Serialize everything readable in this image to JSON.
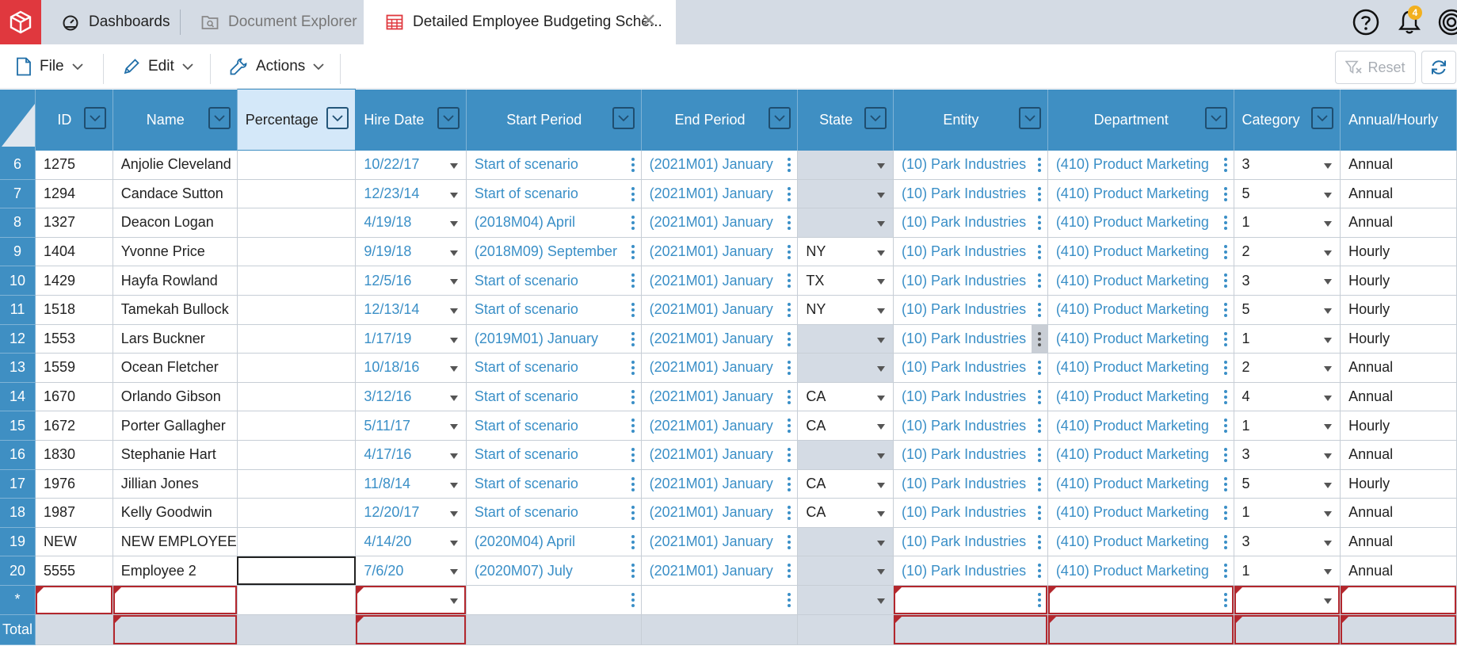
{
  "tabs": {
    "dashboards": "Dashboards",
    "document_explorer": "Document Explorer",
    "active": "Detailed Employee Budgeting Sche..."
  },
  "topbar": {
    "notification_count": "4",
    "close_glyph": "✕"
  },
  "toolbar": {
    "file": "File",
    "edit": "Edit",
    "actions": "Actions",
    "reset": "Reset"
  },
  "columns": {
    "id": "ID",
    "name": "Name",
    "percentage": "Percentage",
    "hire_date": "Hire Date",
    "start_period": "Start Period",
    "end_period": "End Period",
    "state": "State",
    "entity": "Entity",
    "department": "Department",
    "category": "Category",
    "annual_hourly": "Annual/Hourly"
  },
  "rows": [
    {
      "rn": "6",
      "id": "1275",
      "name": "Anjolie Cleveland",
      "pct": "",
      "hire": "10/22/17",
      "start": "Start of scenario",
      "end": "(2021M01) January",
      "state": "",
      "entity": "(10) Park Industries",
      "dept": "(410) Product Marketing",
      "cat": "3",
      "ah": "Annual"
    },
    {
      "rn": "7",
      "id": "1294",
      "name": "Candace Sutton",
      "pct": "",
      "hire": "12/23/14",
      "start": "Start of scenario",
      "end": "(2021M01) January",
      "state": "",
      "entity": "(10) Park Industries",
      "dept": "(410) Product Marketing",
      "cat": "5",
      "ah": "Annual"
    },
    {
      "rn": "8",
      "id": "1327",
      "name": "Deacon Logan",
      "pct": "",
      "hire": "4/19/18",
      "start": "(2018M04) April",
      "end": "(2021M01) January",
      "state": "",
      "entity": "(10) Park Industries",
      "dept": "(410) Product Marketing",
      "cat": "1",
      "ah": "Annual"
    },
    {
      "rn": "9",
      "id": "1404",
      "name": "Yvonne Price",
      "pct": "",
      "hire": "9/19/18",
      "start": "(2018M09) September",
      "end": "(2021M01) January",
      "state": "NY",
      "entity": "(10) Park Industries",
      "dept": "(410) Product Marketing",
      "cat": "2",
      "ah": "Hourly"
    },
    {
      "rn": "10",
      "id": "1429",
      "name": "Hayfa Rowland",
      "pct": "",
      "hire": "12/5/16",
      "start": "Start of scenario",
      "end": "(2021M01) January",
      "state": "TX",
      "entity": "(10) Park Industries",
      "dept": "(410) Product Marketing",
      "cat": "3",
      "ah": "Hourly"
    },
    {
      "rn": "11",
      "id": "1518",
      "name": "Tamekah Bullock",
      "pct": "",
      "hire": "12/13/14",
      "start": "Start of scenario",
      "end": "(2021M01) January",
      "state": "NY",
      "entity": "(10) Park Industries",
      "dept": "(410) Product Marketing",
      "cat": "5",
      "ah": "Hourly"
    },
    {
      "rn": "12",
      "id": "1553",
      "name": "Lars Buckner",
      "pct": "",
      "hire": "1/17/19",
      "start": "(2019M01) January",
      "end": "(2021M01) January",
      "state": "",
      "entity": "(10) Park Industries",
      "dept": "(410) Product Marketing",
      "cat": "1",
      "ah": "Hourly"
    },
    {
      "rn": "13",
      "id": "1559",
      "name": "Ocean Fletcher",
      "pct": "",
      "hire": "10/18/16",
      "start": "Start of scenario",
      "end": "(2021M01) January",
      "state": "",
      "entity": "(10) Park Industries",
      "dept": "(410) Product Marketing",
      "cat": "2",
      "ah": "Annual"
    },
    {
      "rn": "14",
      "id": "1670",
      "name": "Orlando Gibson",
      "pct": "",
      "hire": "3/12/16",
      "start": "Start of scenario",
      "end": "(2021M01) January",
      "state": "CA",
      "entity": "(10) Park Industries",
      "dept": "(410) Product Marketing",
      "cat": "4",
      "ah": "Annual"
    },
    {
      "rn": "15",
      "id": "1672",
      "name": "Porter Gallagher",
      "pct": "",
      "hire": "5/11/17",
      "start": "Start of scenario",
      "end": "(2021M01) January",
      "state": "CA",
      "entity": "(10) Park Industries",
      "dept": "(410) Product Marketing",
      "cat": "1",
      "ah": "Hourly"
    },
    {
      "rn": "16",
      "id": "1830",
      "name": "Stephanie Hart",
      "pct": "",
      "hire": "4/17/16",
      "start": "Start of scenario",
      "end": "(2021M01) January",
      "state": "",
      "entity": "(10) Park Industries",
      "dept": "(410) Product Marketing",
      "cat": "3",
      "ah": "Annual"
    },
    {
      "rn": "17",
      "id": "1976",
      "name": "Jillian Jones",
      "pct": "",
      "hire": "11/8/14",
      "start": "Start of scenario",
      "end": "(2021M01) January",
      "state": "CA",
      "entity": "(10) Park Industries",
      "dept": "(410) Product Marketing",
      "cat": "5",
      "ah": "Hourly"
    },
    {
      "rn": "18",
      "id": "1987",
      "name": "Kelly Goodwin",
      "pct": "",
      "hire": "12/20/17",
      "start": "Start of scenario",
      "end": "(2021M01) January",
      "state": "CA",
      "entity": "(10) Park Industries",
      "dept": "(410) Product Marketing",
      "cat": "1",
      "ah": "Annual"
    },
    {
      "rn": "19",
      "id": "NEW",
      "name": "NEW EMPLOYEE",
      "pct": "",
      "hire": "4/14/20",
      "start": "(2020M04) April",
      "end": "(2021M01) January",
      "state": "",
      "entity": "(10) Park Industries",
      "dept": "(410) Product Marketing",
      "cat": "3",
      "ah": "Annual"
    },
    {
      "rn": "20",
      "id": "5555",
      "name": "Employee 2",
      "pct": "",
      "hire": "7/6/20",
      "start": "(2020M07) July",
      "end": "(2021M01) January",
      "state": "",
      "entity": "(10) Park Industries",
      "dept": "(410) Product Marketing",
      "cat": "1",
      "ah": "Annual"
    }
  ],
  "new_row_marker": "*",
  "total_row_label": "Total"
}
